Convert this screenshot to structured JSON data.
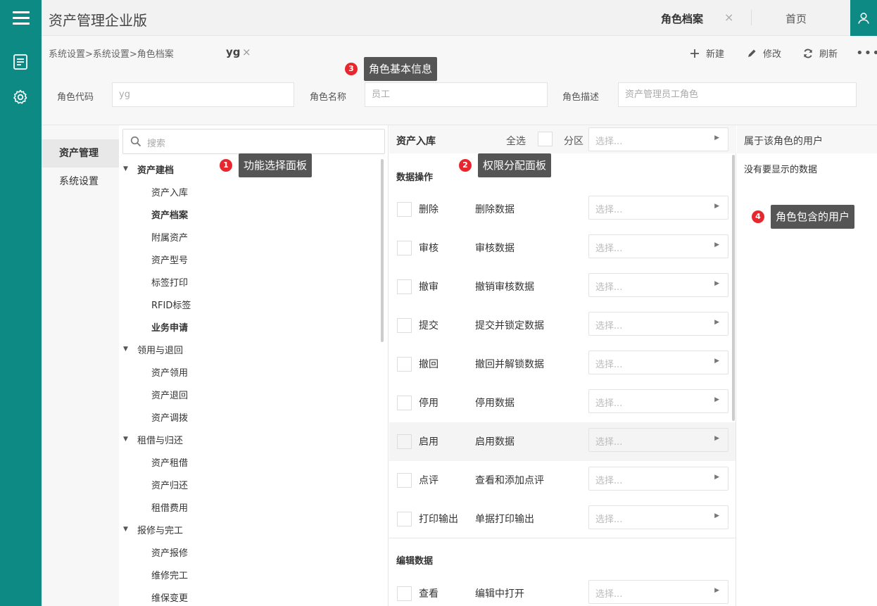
{
  "app": {
    "title": "资产管理企业版"
  },
  "tabs": {
    "active": "角色档案",
    "close": "×",
    "home": "首页"
  },
  "breadcrumb": {
    "path": "系统设置>系统设置>角色档案",
    "doc": "yg",
    "doc_close": "×"
  },
  "toolbar": {
    "new": "新建",
    "edit": "修改",
    "refresh": "刷新",
    "more": "•••"
  },
  "role": {
    "code_label": "角色代码",
    "code_value": "yg",
    "name_label": "角色名称",
    "name_value": "员工",
    "desc_label": "角色描述",
    "desc_value": "资产管理员工角色"
  },
  "modules": [
    "资产管理",
    "系统设置"
  ],
  "search": {
    "placeholder": "搜索"
  },
  "tree": {
    "groups": [
      {
        "label": "资产建档",
        "children": [
          "资产入库",
          "资产档案",
          "附属资产",
          "资产型号",
          "标签打印",
          "RFID标签",
          "业务申请"
        ]
      },
      {
        "label": "领用与退回",
        "children": [
          "资产领用",
          "资产退回",
          "资产调拨"
        ]
      },
      {
        "label": "租借与归还",
        "children": [
          "资产租借",
          "资产归还",
          "租借费用"
        ]
      },
      {
        "label": "报修与完工",
        "children": [
          "资产报修",
          "维修完工",
          "维保变更"
        ]
      }
    ]
  },
  "perm": {
    "title": "资产入库",
    "select_all": "全选",
    "partition": "分区",
    "select_placeholder": "选择...",
    "group1": "数据操作",
    "rows": [
      {
        "op": "删除",
        "desc": "删除数据"
      },
      {
        "op": "审核",
        "desc": "审核数据"
      },
      {
        "op": "撤审",
        "desc": "撤销审核数据"
      },
      {
        "op": "提交",
        "desc": "提交并锁定数据"
      },
      {
        "op": "撤回",
        "desc": "撤回并解锁数据"
      },
      {
        "op": "停用",
        "desc": "停用数据"
      },
      {
        "op": "启用",
        "desc": "启用数据"
      },
      {
        "op": "点评",
        "desc": "查看和添加点评"
      },
      {
        "op": "打印输出",
        "desc": "单据打印输出"
      }
    ],
    "group2": "编辑数据",
    "rows2": [
      {
        "op": "查看",
        "desc": "编辑中打开"
      }
    ]
  },
  "users": {
    "title": "属于该角色的用户",
    "empty": "没有要显示的数据"
  },
  "callouts": [
    {
      "num": "1",
      "text": "功能选择面板"
    },
    {
      "num": "2",
      "text": "权限分配面板"
    },
    {
      "num": "3",
      "text": "角色基本信息"
    },
    {
      "num": "4",
      "text": "角色包含的用户"
    }
  ],
  "colors": {
    "accent": "#0e8a85",
    "callout_dot": "#e7272d",
    "callout_box": "#555555"
  }
}
